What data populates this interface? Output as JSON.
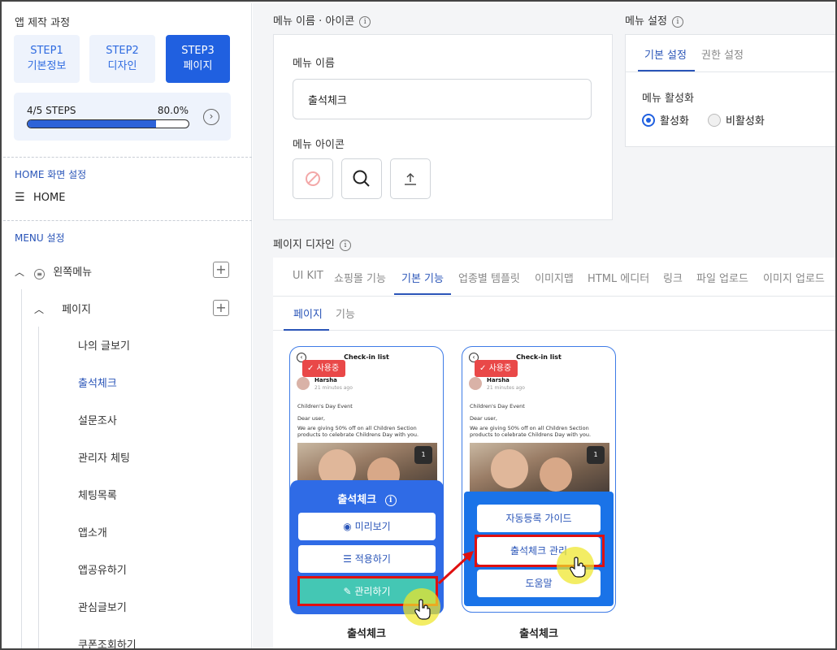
{
  "sidebar": {
    "title": "앱 제작 과정",
    "steps": [
      {
        "line1": "STEP1",
        "line2": "기본정보"
      },
      {
        "line1": "STEP2",
        "line2": "디자인"
      },
      {
        "line1": "STEP3",
        "line2": "페이지"
      }
    ],
    "progress": {
      "label": "4/5 STEPS",
      "percent_text": "80.0%",
      "fraction": 0.8,
      "next_icon": "chevron-right-circle-icon"
    },
    "home_section_label": "HOME 화면 설정",
    "home_item": "HOME",
    "menu_section_label": "MENU 설정",
    "tree_root": "왼쪽메뉴",
    "tree_child": "페이지",
    "leaves": [
      "나의 글보기",
      "출석체크",
      "설문조사",
      "관리자 체팅",
      "체팅목록",
      "앱소개",
      "앱공유하기",
      "관심글보기",
      "쿠폰조회하기"
    ],
    "active_leaf": "출석체크"
  },
  "menu_name": {
    "section_title": "메뉴 이름 · 아이콘",
    "name_label": "메뉴 이름",
    "name_value": "출석체크",
    "icon_label": "메뉴 아이콘",
    "icon_buttons": [
      "none-icon",
      "search-icon",
      "upload-icon"
    ]
  },
  "menu_settings": {
    "section_title": "메뉴 설정",
    "tabs": [
      "기본 설정",
      "권한 설정"
    ],
    "activation_label": "메뉴 활성화",
    "options": [
      "활성화",
      "비활성화"
    ],
    "selected": "활성화"
  },
  "page_design": {
    "section_title": "페이지 디자인",
    "tabs": [
      "UI KIT",
      "쇼핑몰 기능",
      "기본 기능",
      "업종별 템플릿",
      "이미지맵",
      "HTML 에디터",
      "링크",
      "파일 업로드",
      "이미지 업로드"
    ],
    "active_tab": "기본 기능",
    "subtabs": [
      "페이지",
      "기능"
    ],
    "active_subtab": "페이지"
  },
  "cards": [
    {
      "phone_title": "Check-in list",
      "badge": "사용중",
      "author": "Harsha",
      "time": "21 minutes ago",
      "post_title": "Children's Day Event",
      "greeting": "Dear user,",
      "body": "We are giving 50% off on all Children Section products to celebrate Childrens Day with you.",
      "photo_count": "1",
      "overlay_title": "출석체크",
      "buttons": [
        "미리보기",
        "적용하기",
        "관리하기"
      ],
      "caption": "출석체크"
    },
    {
      "phone_title": "Check-in list",
      "badge": "사용중",
      "author": "Harsha",
      "time": "21 minutes ago",
      "post_title": "Children's Day Event",
      "greeting": "Dear user,",
      "body": "We are giving 50% off on all Children Section products to celebrate Childrens Day with you.",
      "photo_count": "1",
      "buttons": [
        "자동등록 가이드",
        "출석체크 관리",
        "도움말"
      ],
      "caption": "출석체크"
    }
  ],
  "colors": {
    "accent": "#2060e0",
    "badge_red": "#e94848",
    "teal": "#44c7b4",
    "highlight_red": "#e01010"
  }
}
